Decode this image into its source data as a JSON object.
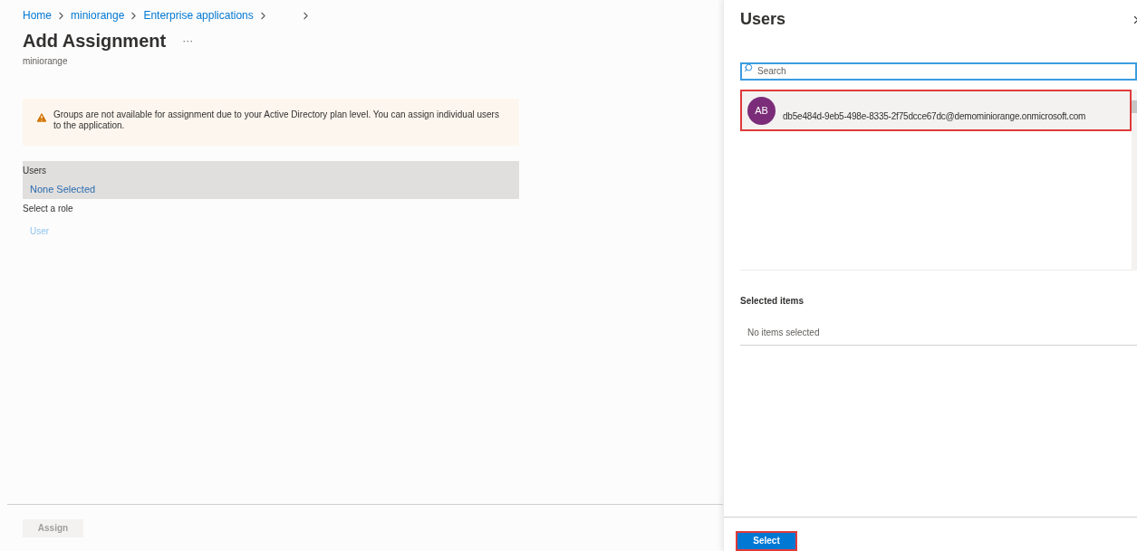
{
  "breadcrumbs": [
    {
      "label": "Home"
    },
    {
      "label": "miniorange"
    },
    {
      "label": "Enterprise applications"
    }
  ],
  "page": {
    "title": "Add Assignment",
    "more": "···",
    "subtitle": "miniorange"
  },
  "warning": {
    "text": "Groups are not available for assignment due to your Active Directory plan level. You can assign individual users to the application."
  },
  "users_section": {
    "label": "Users",
    "value": "None Selected"
  },
  "role_section": {
    "label": "Select a role",
    "value": "User"
  },
  "assign_button": {
    "label": "Assign",
    "disabled": true
  },
  "panel": {
    "title": "Users",
    "search": {
      "placeholder": "Search"
    },
    "results": [
      {
        "initials": "AB",
        "email": "db5e484d-9eb5-498e-8335-2f75dcce67dc@demominiorange.onmicrosoft.com",
        "selected": true
      }
    ],
    "selected_items": {
      "heading": "Selected items",
      "empty": "No items selected"
    },
    "select_button": {
      "label": "Select",
      "disabled": false
    }
  }
}
